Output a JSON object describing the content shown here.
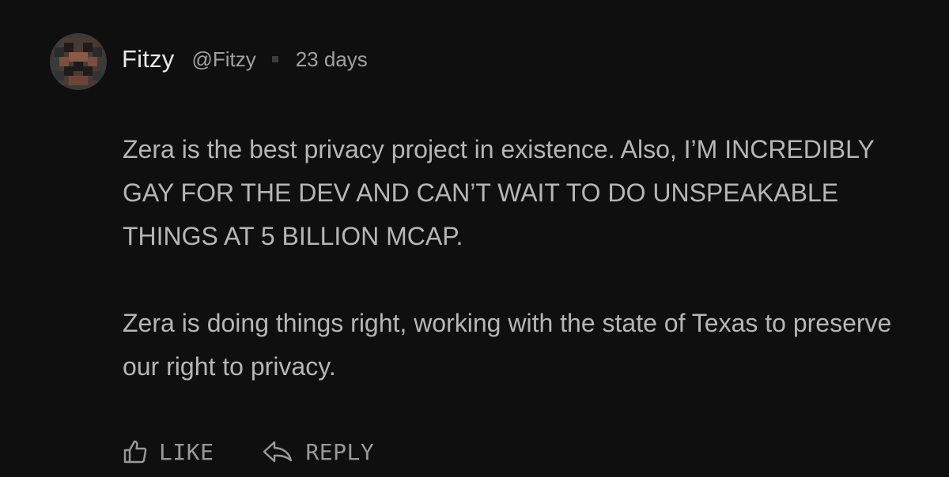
{
  "comment": {
    "author": {
      "display_name": "Fitzy",
      "handle": "@Fitzy",
      "avatar_icon": "pixel-avatar"
    },
    "time_ago": "23 days",
    "paragraphs": [
      "Zera is the best privacy project in existence. Also, I’M INCREDIBLY GAY FOR THE DEV AND CAN’T WAIT TO DO UNSPEAKABLE THINGS AT 5 BILLION MCAP.",
      "Zera is doing things right, working with the state of Texas to preserve our right to privacy."
    ],
    "actions": {
      "like": {
        "label": "LIKE",
        "icon": "thumbs-up-icon"
      },
      "reply": {
        "label": "REPLY",
        "icon": "reply-arrow-icon"
      }
    }
  },
  "colors": {
    "background": "#0f0f0f",
    "name_text": "#e8e8e8",
    "meta_text": "#a0a0a0",
    "body_text": "#b6b6b6",
    "action_text": "#9a9a9a"
  }
}
